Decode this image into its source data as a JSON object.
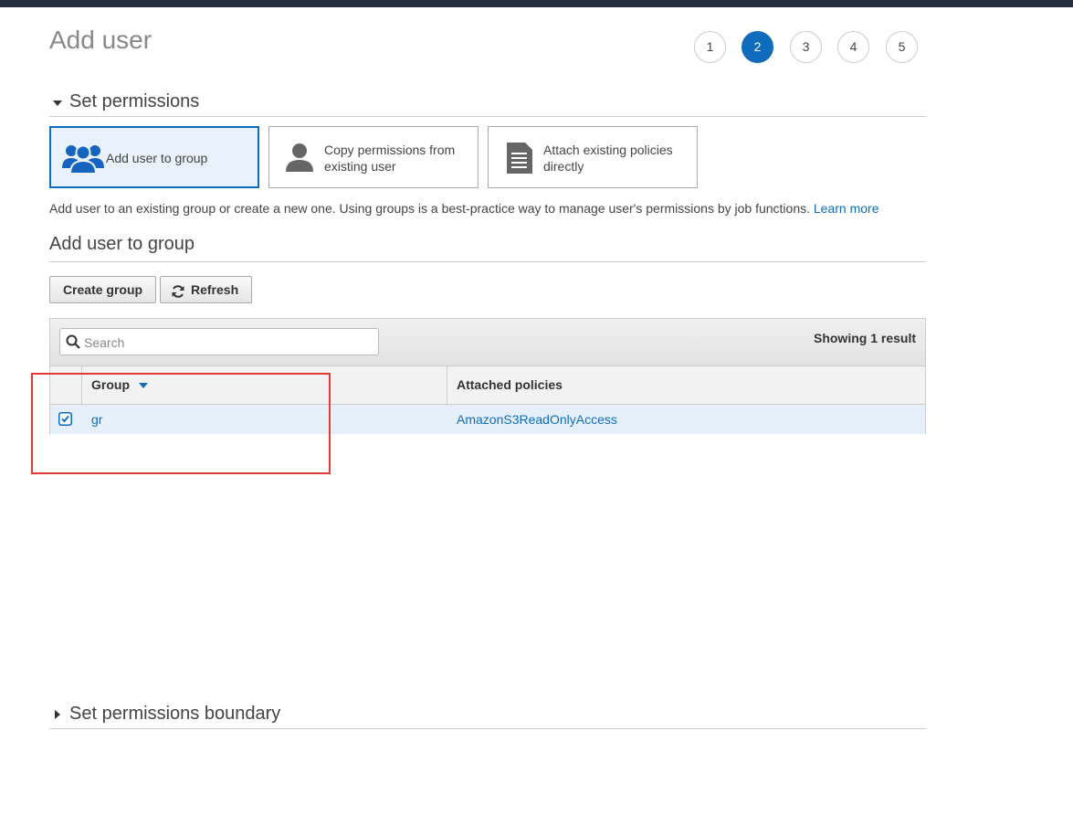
{
  "page": {
    "title": "Add user"
  },
  "steps": [
    "1",
    "2",
    "3",
    "4",
    "5"
  ],
  "active_step": "2",
  "set_permissions": {
    "title": "Set permissions",
    "options": [
      {
        "label_line1": "Add user to group",
        "label_line2": "",
        "icon": "users-group-icon",
        "selected": true
      },
      {
        "label_line1": "Copy permissions from",
        "label_line2": "existing user",
        "icon": "user-icon",
        "selected": false
      },
      {
        "label_line1": "Attach existing policies",
        "label_line2": "directly",
        "icon": "document-icon",
        "selected": false
      }
    ],
    "description": "Add user to an existing group or create a new one. Using groups is a best-practice way to manage user's permissions by job functions.",
    "learn_more": "Learn more"
  },
  "add_user_to_group": {
    "title": "Add user to group",
    "create_group": "Create group",
    "refresh": "Refresh",
    "search_placeholder": "Search",
    "result_count": "Showing 1 result",
    "columns": [
      "Group",
      "Attached policies"
    ],
    "rows": [
      {
        "checked": true,
        "group": "gr",
        "policies": "AmazonS3ReadOnlyAccess"
      }
    ]
  },
  "boundary": {
    "title": "Set permissions boundary"
  },
  "colors": {
    "accent": "#0f6cbd",
    "highlight": "#e53935",
    "topbar": "#232f3e"
  }
}
